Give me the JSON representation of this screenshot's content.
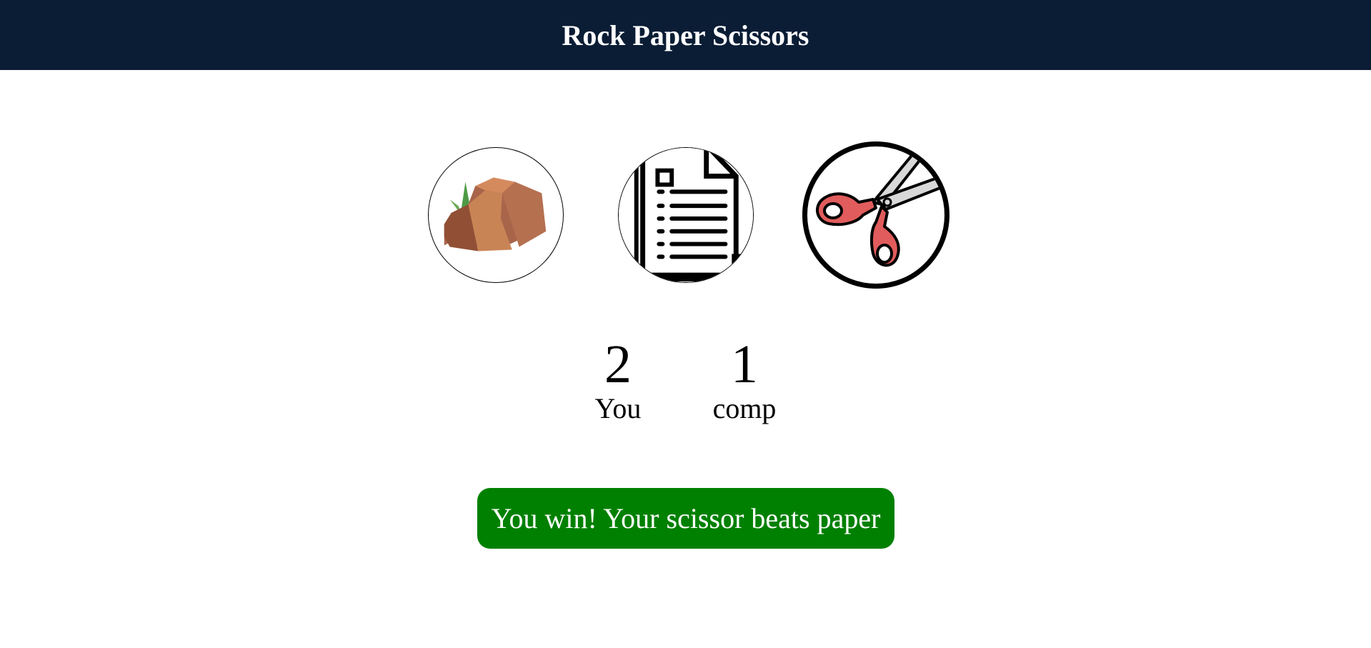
{
  "header": {
    "title": "Rock Paper Scissors"
  },
  "choices": [
    {
      "id": "rock",
      "icon": "rock-icon"
    },
    {
      "id": "paper",
      "icon": "paper-document-icon"
    },
    {
      "id": "scissors",
      "icon": "scissors-icon"
    }
  ],
  "score": {
    "user": {
      "value": "2",
      "label": "You"
    },
    "comp": {
      "value": "1",
      "label": "comp"
    }
  },
  "message": {
    "text": "You win! Your scissor beats paper",
    "background": "#008000"
  },
  "colors": {
    "header_bg": "#0a1d35",
    "win": "#008000"
  }
}
